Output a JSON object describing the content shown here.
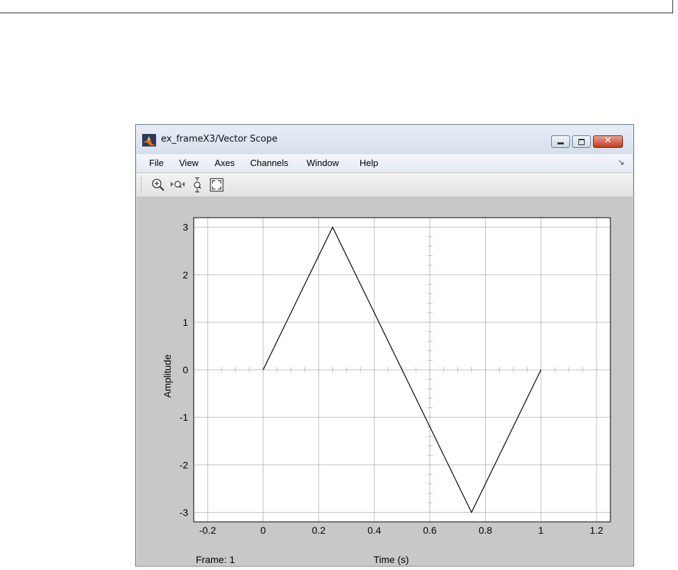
{
  "window": {
    "title": "ex_frameX3/Vector Scope",
    "controls": {
      "close_glyph": "✕"
    }
  },
  "menu": {
    "items": [
      "File",
      "View",
      "Axes",
      "Channels",
      "Window",
      "Help"
    ],
    "overflow_glyph": "↘"
  },
  "toolbar": {
    "tools": [
      "zoom-in-icon",
      "zoom-x-icon",
      "zoom-y-icon",
      "autoscale-icon"
    ]
  },
  "scope": {
    "frame_label": "Frame: 1",
    "line_color": "#000000",
    "grid_color": "#bfbfbf",
    "background": "#ffffff"
  },
  "chart_data": {
    "type": "line",
    "title": "",
    "xlabel": "Time (s)",
    "ylabel": "Amplitude",
    "xlim": [
      -0.25,
      1.25
    ],
    "ylim": [
      -3.2,
      3.2
    ],
    "xticks": [
      -0.2,
      0,
      0.2,
      0.4,
      0.6,
      0.8,
      1,
      1.2
    ],
    "xtick_labels": [
      "-0.2",
      "0",
      "0.2",
      "0.4",
      "0.6",
      "0.8",
      "1",
      "1.2"
    ],
    "yticks": [
      3,
      2,
      1,
      0,
      -1,
      -2,
      -3
    ],
    "ytick_labels": [
      "3",
      "2",
      "1",
      "0",
      "-1",
      "-2",
      "-3"
    ],
    "grid": true,
    "series": [
      {
        "x": [
          0,
          0.25,
          0.75,
          1
        ],
        "y": [
          0,
          3,
          -3,
          0
        ]
      }
    ]
  }
}
